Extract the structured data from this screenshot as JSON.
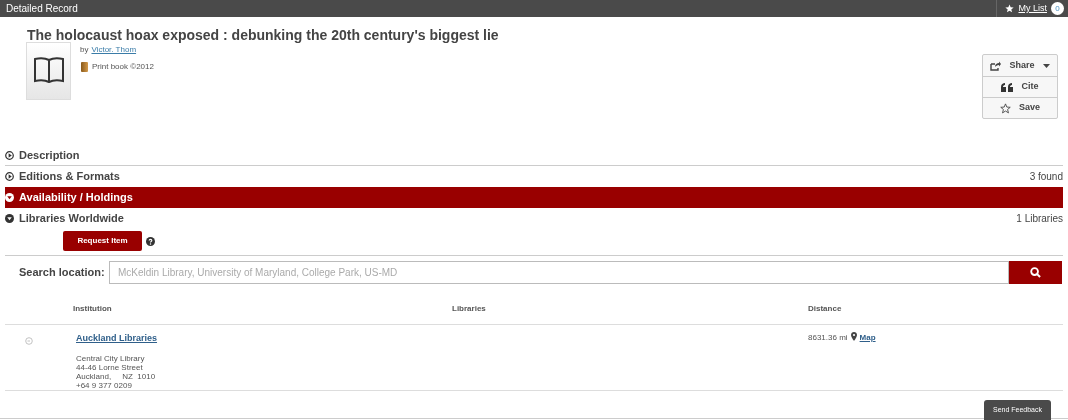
{
  "top_bar": {
    "title": "Detailed Record",
    "my_list": "My List",
    "my_list_count": "0"
  },
  "record": {
    "title": "The holocaust hoax exposed : debunking the 20th century's biggest lie",
    "by": "by",
    "author": "Victor. Thom",
    "format": "Print book ©2012"
  },
  "actions": [
    {
      "kind": "share",
      "label": "Share"
    },
    {
      "kind": "cite",
      "label": "Cite"
    },
    {
      "kind": "save",
      "label": "Save"
    }
  ],
  "sections": [
    {
      "label": "Description",
      "expanded": false,
      "selected": false
    },
    {
      "label": "Editions & Formats",
      "expanded": false,
      "selected": false,
      "count": "3 found"
    },
    {
      "label": "Availability / Holdings",
      "expanded": true,
      "selected": true
    },
    {
      "label": "Libraries Worldwide",
      "expanded": true,
      "selected": false,
      "count": "1 Libraries"
    }
  ],
  "request_button": "Request Item",
  "search": {
    "label": "Search location:",
    "placeholder": "McKeldin Library, University of Maryland, College Park, US-MD"
  },
  "table": {
    "columns": [
      "Institution",
      "Libraries",
      "Distance"
    ],
    "rows": [
      {
        "institution": "Auckland Libraries",
        "address": [
          "Central City Library",
          "44-46 Lorne Street",
          "Auckland,     NZ  1010",
          "+64 9 377 0209"
        ],
        "distance": "8631.36 mi",
        "map": "Map"
      }
    ]
  },
  "feedback_button": "Send Feedback"
}
